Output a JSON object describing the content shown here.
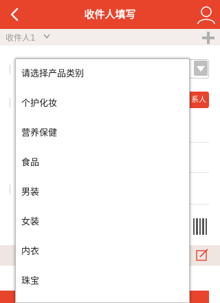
{
  "header": {
    "title": "收件人填写",
    "back_icon": "chevron-left-icon",
    "user_icon": "user-icon",
    "color": "#e8432b"
  },
  "recipient": {
    "label": "收件人1",
    "add_icon": "plus-icon"
  },
  "form": {
    "contact_button_label": "系人"
  },
  "dropdown": {
    "options": [
      "请选择产品类别",
      "个护化妆",
      "营养保健",
      "食品",
      "男装",
      "女装",
      "内衣",
      "珠宝"
    ]
  }
}
